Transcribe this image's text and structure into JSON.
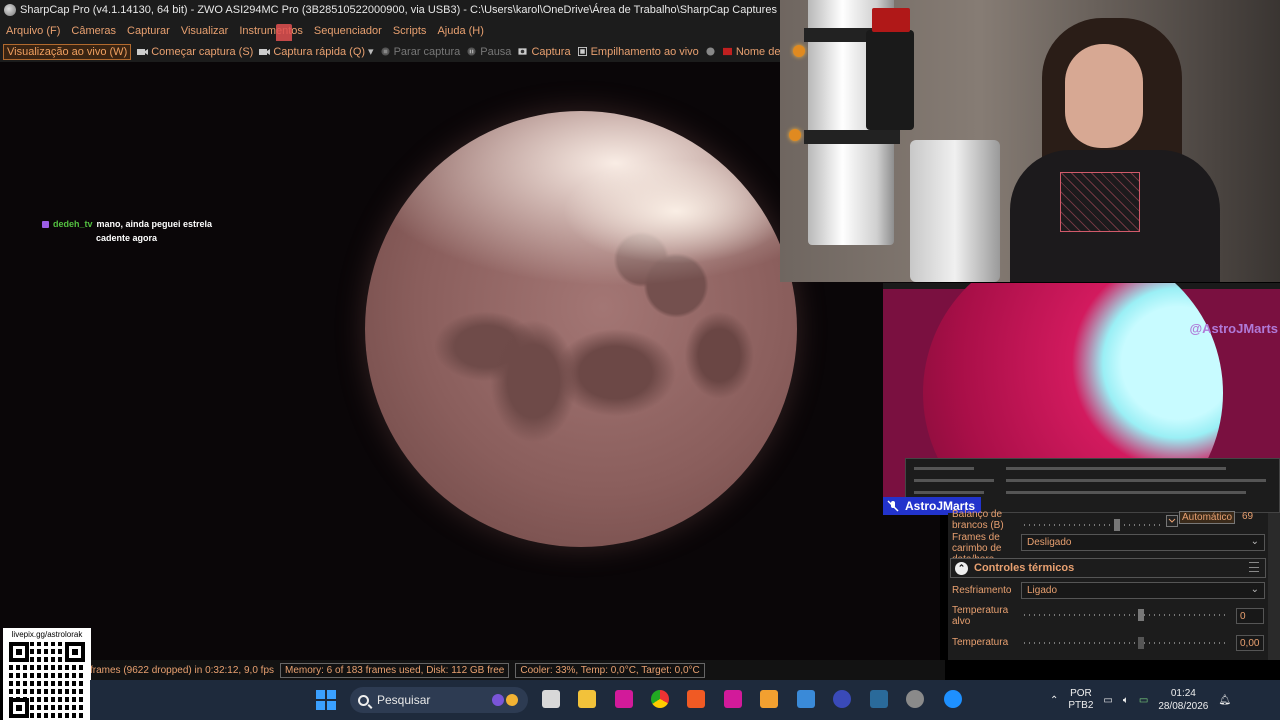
{
  "window": {
    "title": "SharpCap Pro (v4.1.14130, 64 bit) - ZWO ASI294MC Pro (3B28510522000900, via USB3) - C:\\Users\\karol\\OneDrive\\Área de Trabalho\\SharpCap Captures"
  },
  "menu": [
    "Arquivo (F)",
    "Câmeras",
    "Capturar",
    "Visualizar",
    "Instrumentos",
    "Sequenciador",
    "Scripts",
    "Ajuda (H)"
  ],
  "toolbar": {
    "live_view": "Visualização ao vivo (W)",
    "start_capture": "Começar captura (S)",
    "quick_capture": "Captura rápida (Q)",
    "stop_capture": "Parar captura",
    "pause": "Pausa",
    "capture": "Captura",
    "live_stack": "Empilhamento ao vivo",
    "target_name": "Nome de destino"
  },
  "chat": {
    "user": "dedeh_tv",
    "message_line1": "mano, ainda peguei estrela",
    "message_line2": "cadente agora"
  },
  "statusbar": {
    "frames": "frames (9622 dropped) in 0:32:12, 9,0 fps",
    "memory": "Memory: 6 of 183 frames used, Disk: 112 GB free",
    "cooler": "Cooler: 33%, Temp: 0,0°C, Target: 0,0°C"
  },
  "qr": {
    "label": "livepix.gg/astrolorak"
  },
  "screen2": {
    "tag": "@AstroJMarts"
  },
  "handle": {
    "name": "AstroJMarts"
  },
  "panel": {
    "white_balance_label": "Balanço de brancos (B)",
    "white_balance_mode": "Automático",
    "white_balance_value": "69",
    "timestamp_label": "Frames de carimbo de data/hora",
    "timestamp_value": "Desligado",
    "thermal_section": "Controles térmicos",
    "cooling_label": "Resfriamento",
    "cooling_value": "Ligado",
    "target_temp_label": "Temperatura alvo",
    "target_temp_value": "0",
    "temperature_label": "Temperatura",
    "temperature_value": "0,00"
  },
  "taskbar": {
    "search": "Pesquisar",
    "lang_line1": "POR",
    "lang_line2": "PTB2",
    "time": "01:24",
    "date": "28/08/2026"
  }
}
